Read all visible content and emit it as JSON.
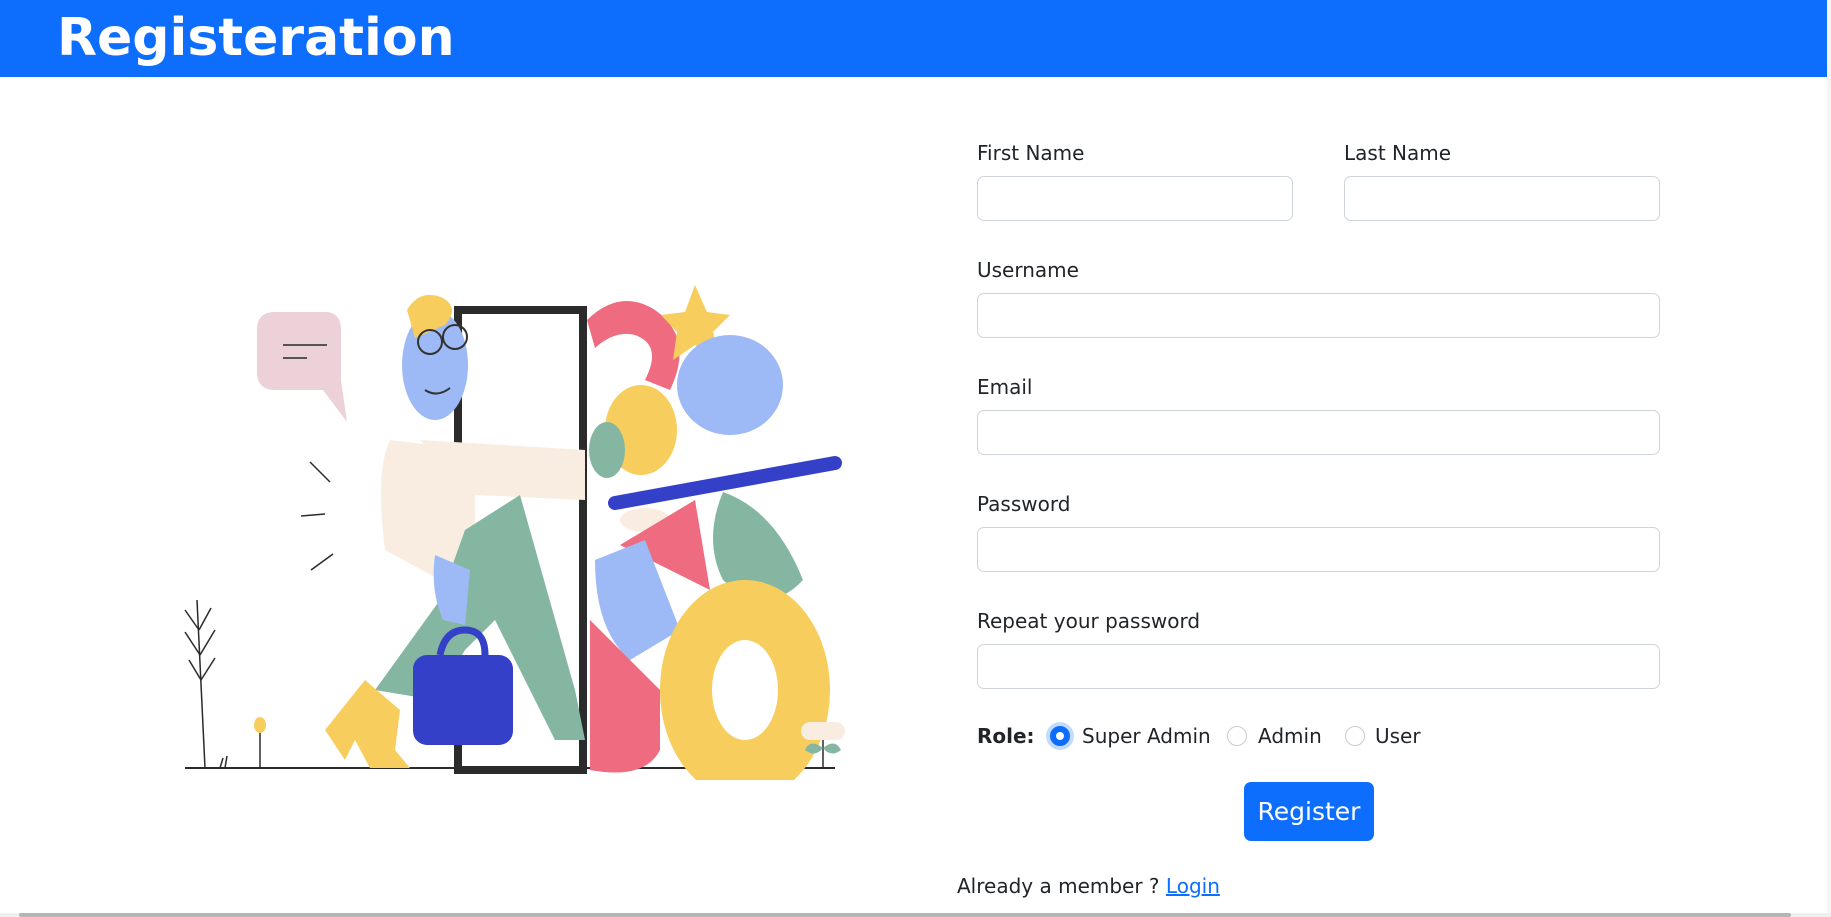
{
  "header": {
    "title": "Registeration",
    "color": "#0d6efd"
  },
  "illustration": {
    "name": "person-walking-through-door-with-shapes"
  },
  "form": {
    "first_name": {
      "label": "First Name",
      "value": "",
      "placeholder": ""
    },
    "last_name": {
      "label": "Last Name",
      "value": "",
      "placeholder": ""
    },
    "username": {
      "label": "Username",
      "value": "",
      "placeholder": ""
    },
    "email": {
      "label": "Email",
      "value": "",
      "placeholder": ""
    },
    "password": {
      "label": "Password",
      "value": "",
      "placeholder": ""
    },
    "repeat_password": {
      "label": "Repeat your password",
      "value": "",
      "placeholder": ""
    },
    "role": {
      "label": "Role:",
      "options": [
        "Super Admin",
        "Admin",
        "User"
      ],
      "selected": "Super Admin"
    },
    "submit_label": "Register"
  },
  "footer": {
    "prompt": "Already a member ?",
    "login_label": "Login"
  }
}
